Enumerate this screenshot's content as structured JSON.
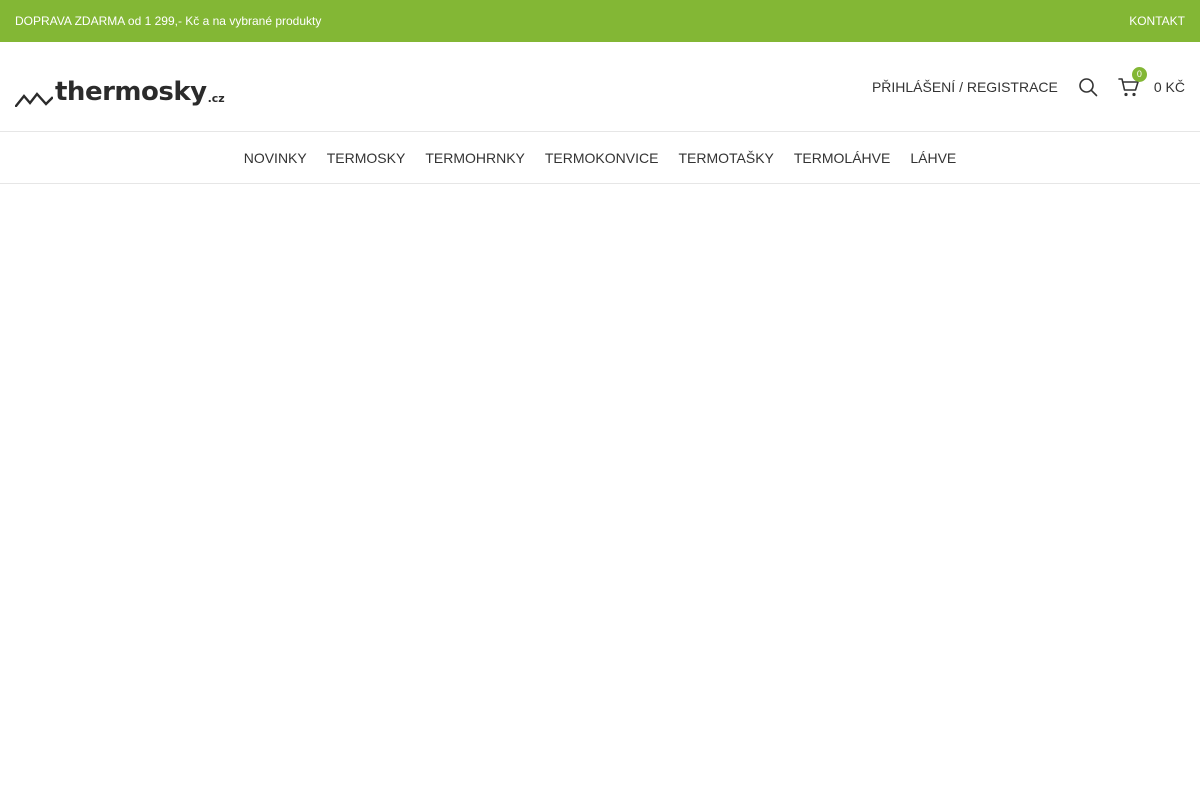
{
  "topbar": {
    "promo": "DOPRAVA ZDARMA od 1 299,- Kč a na vybrané produkty",
    "contact": "KONTAKT",
    "background": "#83b735"
  },
  "header": {
    "logo_word": "thermosky",
    "logo_tld": ".cz",
    "login_label": "PŘIHLÁŠENÍ / REGISTRACE",
    "search_icon": "search-icon",
    "cart_icon": "cart-icon",
    "cart_count": "0",
    "cart_total": "0 KČ"
  },
  "nav": {
    "items": [
      {
        "label": "NOVINKY"
      },
      {
        "label": "TERMOSKY"
      },
      {
        "label": "TERMOHRNKY"
      },
      {
        "label": "TERMOKONVICE"
      },
      {
        "label": "TERMOTAŠKY"
      },
      {
        "label": "TERMOLÁHVE"
      },
      {
        "label": "LÁHVE"
      }
    ]
  },
  "colors": {
    "accent": "#83b735",
    "text": "#333333"
  }
}
